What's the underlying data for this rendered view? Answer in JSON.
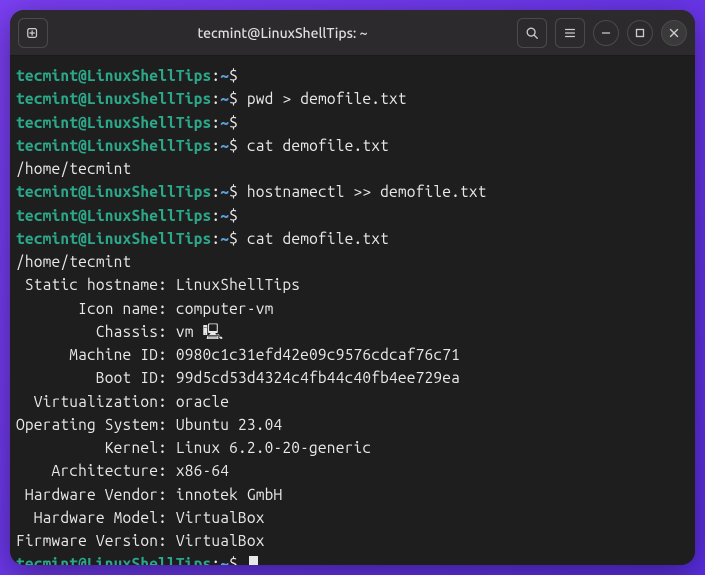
{
  "window": {
    "title": "tecmint@LinuxShellTips: ~"
  },
  "prompt": {
    "user_host": "tecmint@LinuxShellTips",
    "path": "~",
    "symbol": "$"
  },
  "lines": [
    {
      "type": "prompt",
      "cmd": ""
    },
    {
      "type": "prompt",
      "cmd": "pwd > demofile.txt"
    },
    {
      "type": "prompt",
      "cmd": ""
    },
    {
      "type": "prompt",
      "cmd": "cat demofile.txt"
    },
    {
      "type": "output",
      "text": "/home/tecmint"
    },
    {
      "type": "prompt",
      "cmd": "hostnamectl >> demofile.txt"
    },
    {
      "type": "prompt",
      "cmd": ""
    },
    {
      "type": "prompt",
      "cmd": "cat demofile.txt"
    },
    {
      "type": "output",
      "text": "/home/tecmint"
    },
    {
      "type": "kv",
      "key": " Static hostname:",
      "val": " LinuxShellTips"
    },
    {
      "type": "kv",
      "key": "       Icon name:",
      "val": " computer-vm"
    },
    {
      "type": "kv",
      "key": "         Chassis:",
      "val": " vm 🖳"
    },
    {
      "type": "kv",
      "key": "      Machine ID:",
      "val": " 0980c1c31efd42e09c9576cdcaf76c71"
    },
    {
      "type": "kv",
      "key": "         Boot ID:",
      "val": " 99d5cd53d4324c4fb44c40fb4ee729ea"
    },
    {
      "type": "kv",
      "key": "  Virtualization:",
      "val": " oracle"
    },
    {
      "type": "kv",
      "key": "Operating System:",
      "val": " Ubuntu 23.04"
    },
    {
      "type": "kv",
      "key": "          Kernel:",
      "val": " Linux 6.2.0-20-generic"
    },
    {
      "type": "kv",
      "key": "    Architecture:",
      "val": " x86-64"
    },
    {
      "type": "kv",
      "key": " Hardware Vendor:",
      "val": " innotek GmbH"
    },
    {
      "type": "kv",
      "key": "  Hardware Model:",
      "val": " VirtualBox"
    },
    {
      "type": "kv",
      "key": "Firmware Version:",
      "val": " VirtualBox"
    },
    {
      "type": "prompt-cursor",
      "cmd": ""
    }
  ]
}
